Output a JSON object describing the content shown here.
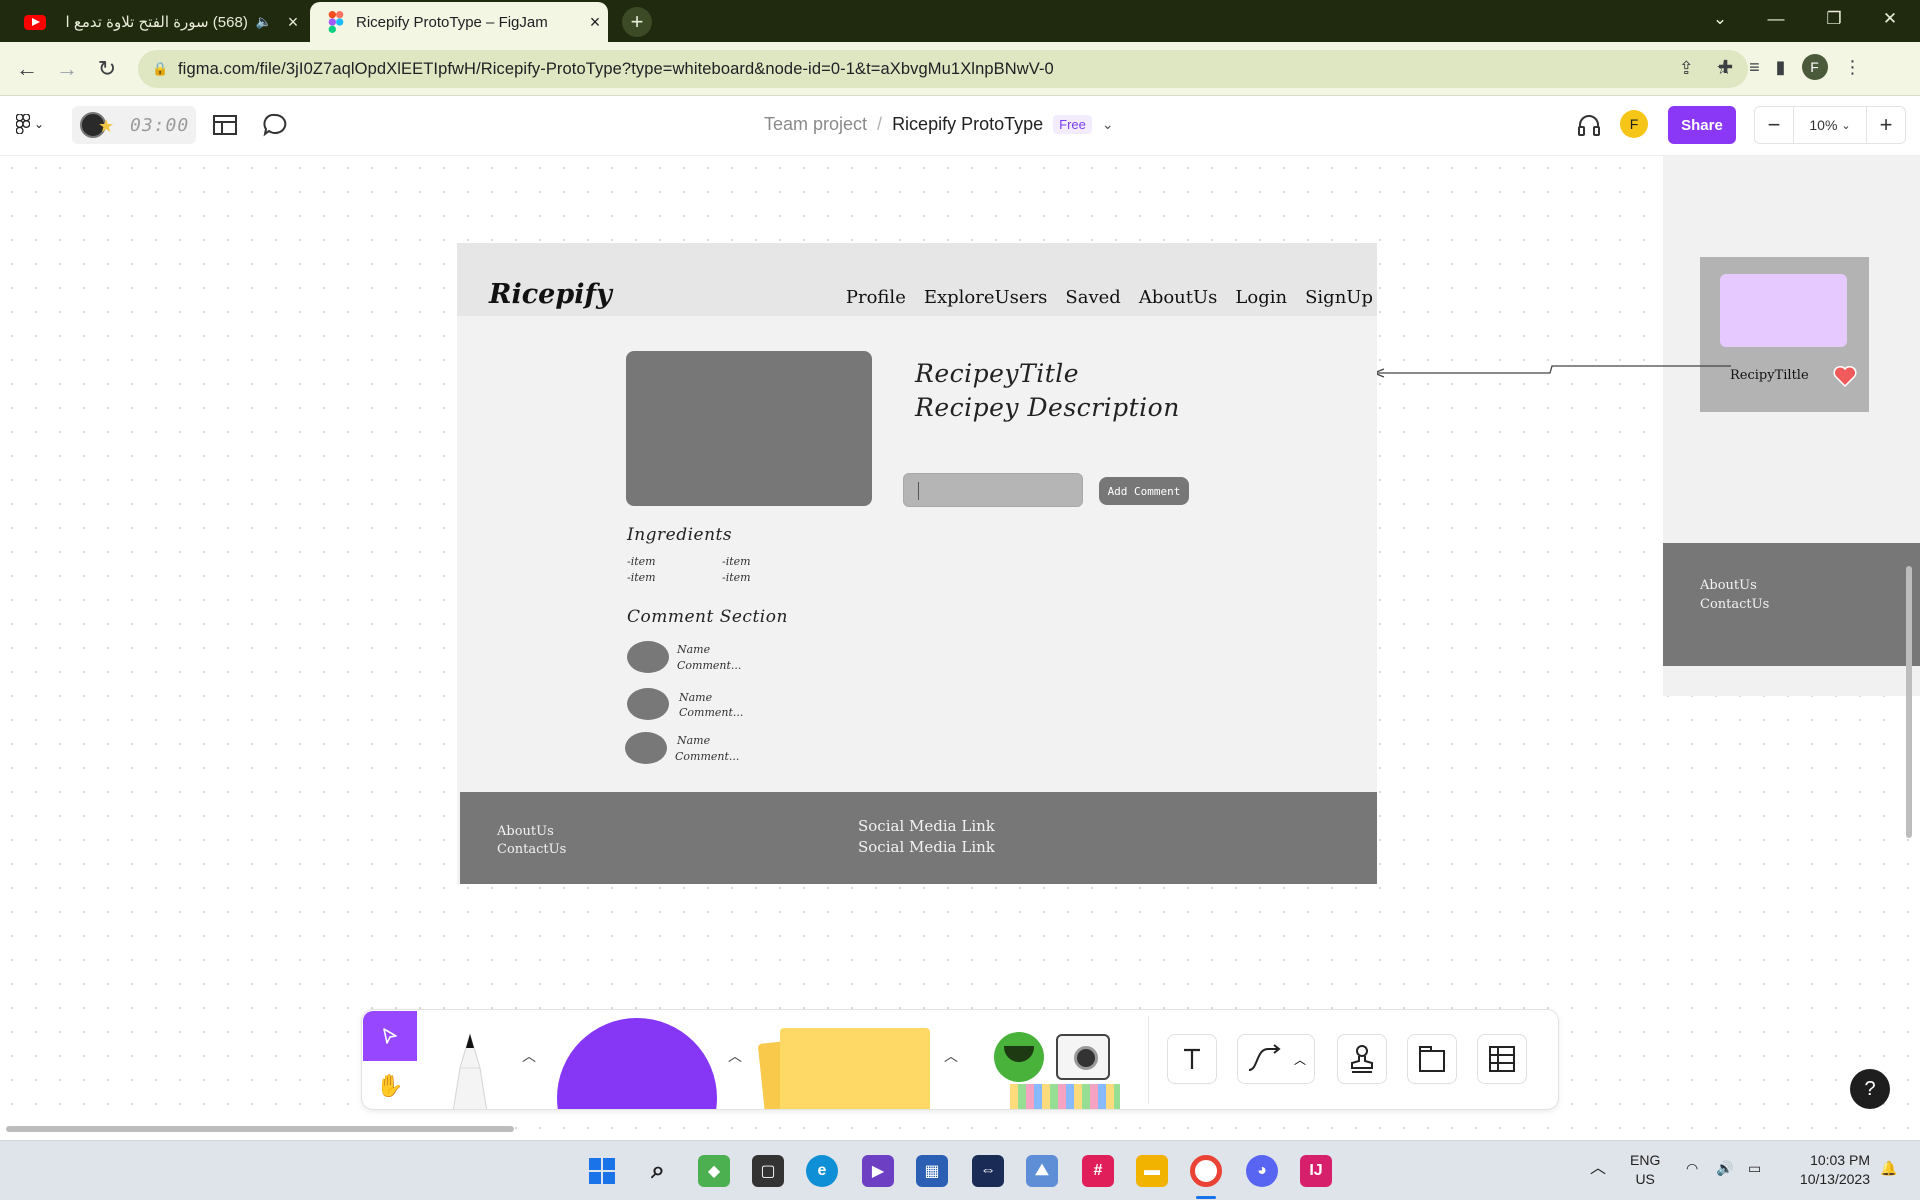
{
  "browser": {
    "tabs": [
      {
        "title": "(568) سورة الفتح تلاوة تدمع ا",
        "active": false,
        "icon": "youtube-icon"
      },
      {
        "title": "Ricepify ProtoType – FigJam",
        "active": true,
        "icon": "figma-icon"
      }
    ],
    "url": "figma.com/file/3jI0Z7aqlOpdXlEETIpfwH/Ricepify-ProtoType?type=whiteboard&node-id=0-1&t=aXbvgMu1XlnpBNwV-0",
    "profile_initial": "F"
  },
  "figjam": {
    "timer": "03:00",
    "breadcrumb": {
      "team": "Team project",
      "separator": "/",
      "file": "Ricepify ProtoType",
      "plan": "Free"
    },
    "user_initial": "F",
    "share_label": "Share",
    "zoom": "10%",
    "zoom_minus": "−",
    "zoom_plus": "+"
  },
  "frame": {
    "brand": "Ricepify",
    "nav": [
      "Profile",
      "ExploreUsers",
      "Saved",
      "AboutUs",
      "Login",
      "SignUp"
    ],
    "recipe_title": "RecipeyTitle",
    "recipe_description": "Recipey Description",
    "add_comment_label": "Add Comment",
    "ingredients_heading": "Ingredients",
    "ingredients": [
      "-item",
      "-item",
      "-item",
      "-item"
    ],
    "comments_heading": "Comment Section",
    "comments": [
      {
        "name": "Name",
        "text": "Comment..."
      },
      {
        "name": "Name",
        "text": "Comment..."
      },
      {
        "name": "Name",
        "text": "Comment..."
      }
    ],
    "footer_links": [
      "AboutUs",
      "ContactUs"
    ],
    "footer_social": [
      "Social Media Link",
      "Social Media Link"
    ]
  },
  "side_frame": {
    "card_title": "RecipyTiltle",
    "footer_links": [
      "AboutUs",
      "ContactUs"
    ]
  },
  "dock": {
    "tools": [
      "select-tool",
      "hand-tool",
      "marker-tool",
      "shape-tool",
      "sticky-note-tool",
      "stickers-tool",
      "text-tool",
      "connector-tool",
      "stamp-tool",
      "section-tool",
      "table-tool"
    ]
  },
  "help_label": "?",
  "taskbar": {
    "lang_line1": "ENG",
    "lang_line2": "US",
    "time": "10:03 PM",
    "date": "10/13/2023"
  },
  "colors": {
    "accent_purple": "#9747ff",
    "share_purple": "#8a38f5",
    "card_image": "#e5c9ff",
    "heart": "#f05a5a"
  }
}
